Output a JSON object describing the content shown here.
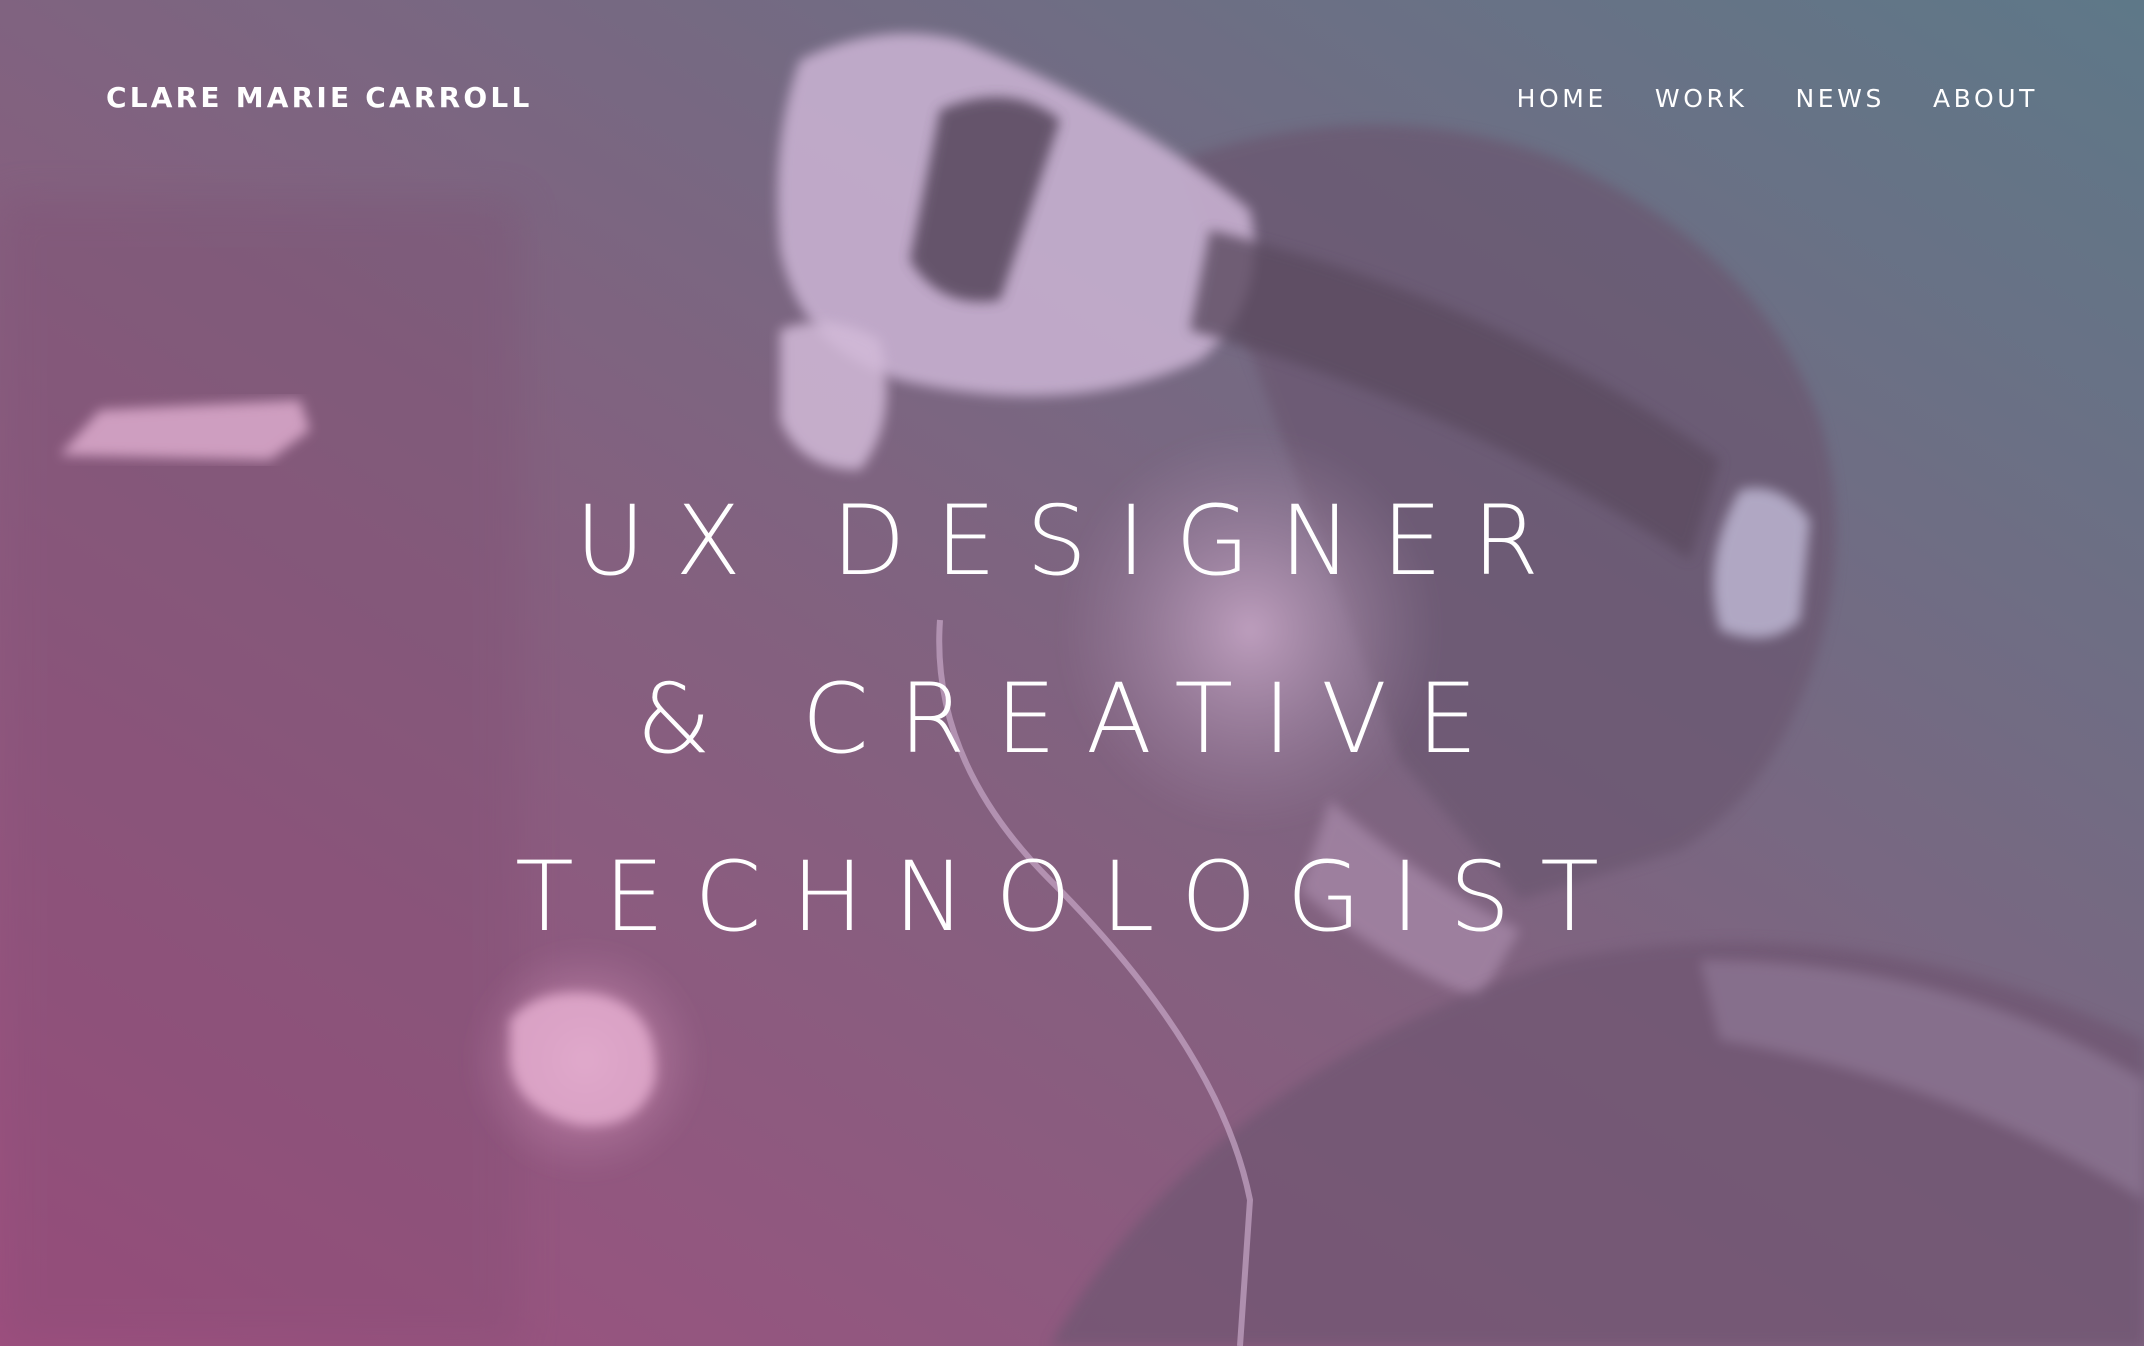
{
  "site": {
    "title": "CLARE MARIE CARROLL"
  },
  "nav": {
    "items": [
      {
        "label": "HOME"
      },
      {
        "label": "WORK"
      },
      {
        "label": "NEWS"
      },
      {
        "label": "ABOUT"
      }
    ]
  },
  "hero": {
    "lines": [
      "UX DESIGNER",
      "& CREATIVE",
      "TECHNOLOGIST"
    ],
    "background_image": "person-wearing-vr-headset-photo",
    "gradient_colors": {
      "bottom_left": "#9e537f",
      "top_right": "#5f7786"
    }
  }
}
